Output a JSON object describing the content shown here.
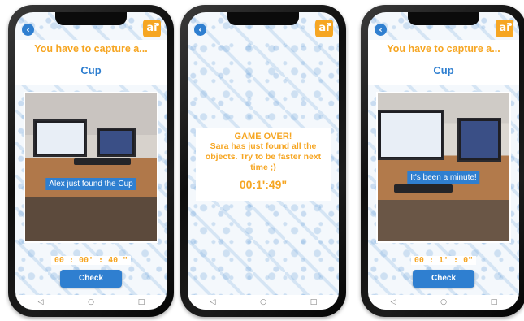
{
  "screens": [
    {
      "header": {
        "prompt": "You have to capture a...",
        "object": "Cup"
      },
      "toast": "Alex just found the Cup",
      "timer": "00 : 00' : 40 \"",
      "check_label": "Check"
    },
    {
      "game_over": {
        "title": "GAME OVER!",
        "message": "Sara has just found all the objects. Try to be faster next time ;)",
        "time": "00:1':49\""
      }
    },
    {
      "header": {
        "prompt": "You have to capture a...",
        "object": "Cup"
      },
      "toast": "It's been a minute!",
      "timer": "00 : 1' : 0\"",
      "check_label": "Check"
    }
  ],
  "logo_text": "ai",
  "icons": {
    "back": "back-arrow-icon",
    "nav_back": "triangle-back-icon",
    "nav_home": "circle-home-icon",
    "nav_recent": "square-recents-icon"
  },
  "colors": {
    "accent_orange": "#f6a623",
    "accent_blue": "#2f7fd0",
    "background": "#f4f8fc"
  }
}
